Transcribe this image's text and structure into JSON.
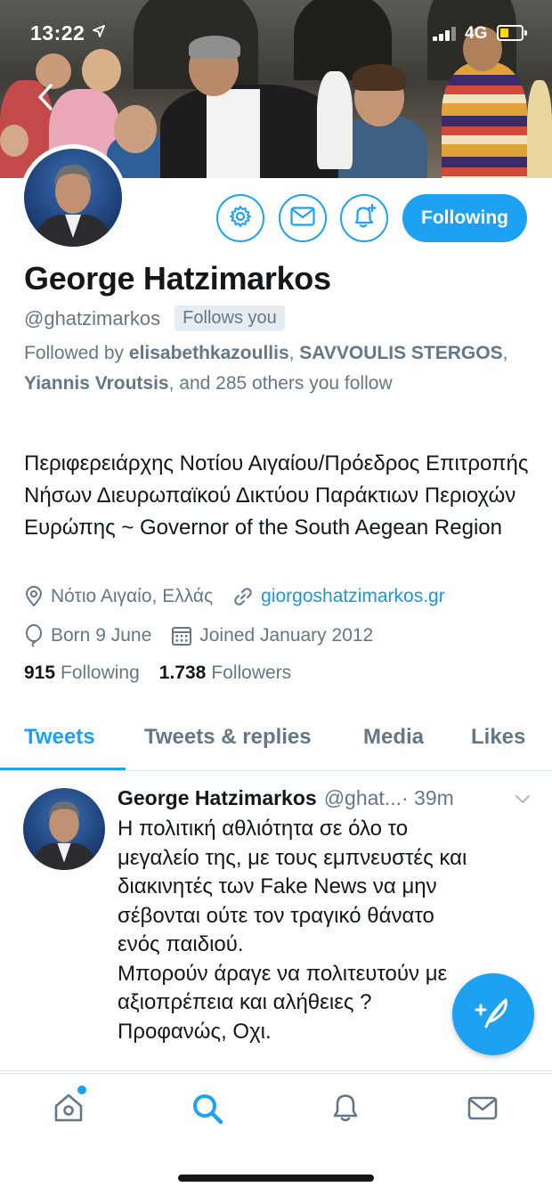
{
  "status_bar": {
    "time": "13:22",
    "network": "4G",
    "icons": [
      "location-arrow-icon",
      "signal-icon",
      "battery-icon"
    ]
  },
  "profile": {
    "name": "George Hatzimarkos",
    "handle": "@ghatzimarkos",
    "follows_you": "Follows you",
    "followed_by_prefix": "Followed by ",
    "followed_by_names": [
      "elisabethkazoullis",
      "SAVVOULIS STERGOS",
      "Yiannis Vroutsis"
    ],
    "followed_by_sep1": ", ",
    "followed_by_sep2": ", ",
    "followed_by_suffix": ", and 285 others you follow",
    "bio": "Περιφερειάρχης Νοτίου Αιγαίου/Πρόεδρος Επιτροπής Νήσων Διευρωπαϊκού Δικτύου Παράκτιων Περιοχών Ευρώπης ~ Governor of the South Aegean Region",
    "location": "Νότιο Αιγαίο, Ελλάς",
    "website": "giorgoshatzimarkos.gr",
    "birthday": "Born 9 June",
    "joined": "Joined January 2012",
    "following_count": "915",
    "following_label": "Following",
    "followers_count": "1.738",
    "followers_label": "Followers"
  },
  "actions": {
    "following_button": "Following",
    "icons": [
      "settings-gear-icon",
      "message-envelope-icon",
      "notification-bell-icon"
    ]
  },
  "tabs": [
    {
      "label": "Tweets",
      "active": true
    },
    {
      "label": "Tweets & replies",
      "active": false
    },
    {
      "label": "Media",
      "active": false
    },
    {
      "label": "Likes",
      "active": false
    }
  ],
  "tweet": {
    "author": "George Hatzimarkos",
    "handle": "@ghat...",
    "time": "· 39m",
    "text": "Η πολιτική αθλιότητα σε όλο το\nμεγαλείο της, με τους εμπνευστές και\nδιακινητές των Fake News να μην\nσέβονται ούτε τον τραγικό θάνατο\nενός παιδιού.\nΜπορούν άραγε να πολιτευτούν με\nαξιοπρέπεια και αλήθειες ?\nΠροφανώς, Οχι."
  },
  "bottom_nav": [
    "home-icon",
    "search-icon",
    "notifications-bell-icon",
    "messages-envelope-icon"
  ],
  "colors": {
    "accent": "#1da1f2",
    "secondary_text": "#657786",
    "link": "#1b95e0"
  }
}
